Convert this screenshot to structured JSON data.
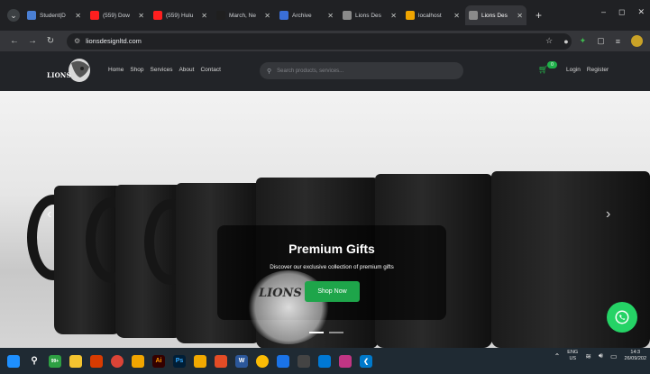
{
  "browser": {
    "tabs": [
      {
        "title": "Student|D",
        "color": "#4a7fd4",
        "active": false
      },
      {
        "title": "(559) Dow",
        "color": "#ff1f1f",
        "active": false
      },
      {
        "title": "(559) Hulu",
        "color": "#ff1f1f",
        "active": false
      },
      {
        "title": "March, Ne",
        "color": "#1f1f1f",
        "active": false
      },
      {
        "title": "Archive",
        "color": "#3a6fd8",
        "active": false
      },
      {
        "title": "Lions Des",
        "color": "#8a8a8a",
        "active": false
      },
      {
        "title": "localhost",
        "color": "#f0a500",
        "active": false
      },
      {
        "title": "Lions Des",
        "color": "#8a8a8a",
        "active": true
      }
    ],
    "new_tab": "+",
    "url": "lionsdesignltd.com"
  },
  "site": {
    "logo_text": "LIONS",
    "nav": [
      "Home",
      "Shop",
      "Services",
      "About",
      "Contact"
    ],
    "search_placeholder": "Search products, services...",
    "cart_count": "0",
    "login": "Login",
    "register": "Register"
  },
  "hero": {
    "title": "Premium Gifts",
    "subtitle": "Discover our exclusive collection of premium gifts",
    "cta": "Shop Now",
    "watermark": "LIONS",
    "slides": 2,
    "active_slide": 0
  },
  "taskbar": {
    "badge": "99+",
    "lang_top": "ENG",
    "lang_bottom": "US",
    "time": "14:3",
    "date": "26/09/202"
  },
  "colors": {
    "accent": "#1ea54a",
    "whatsapp": "#25d366",
    "nav_bg": "#222428"
  }
}
